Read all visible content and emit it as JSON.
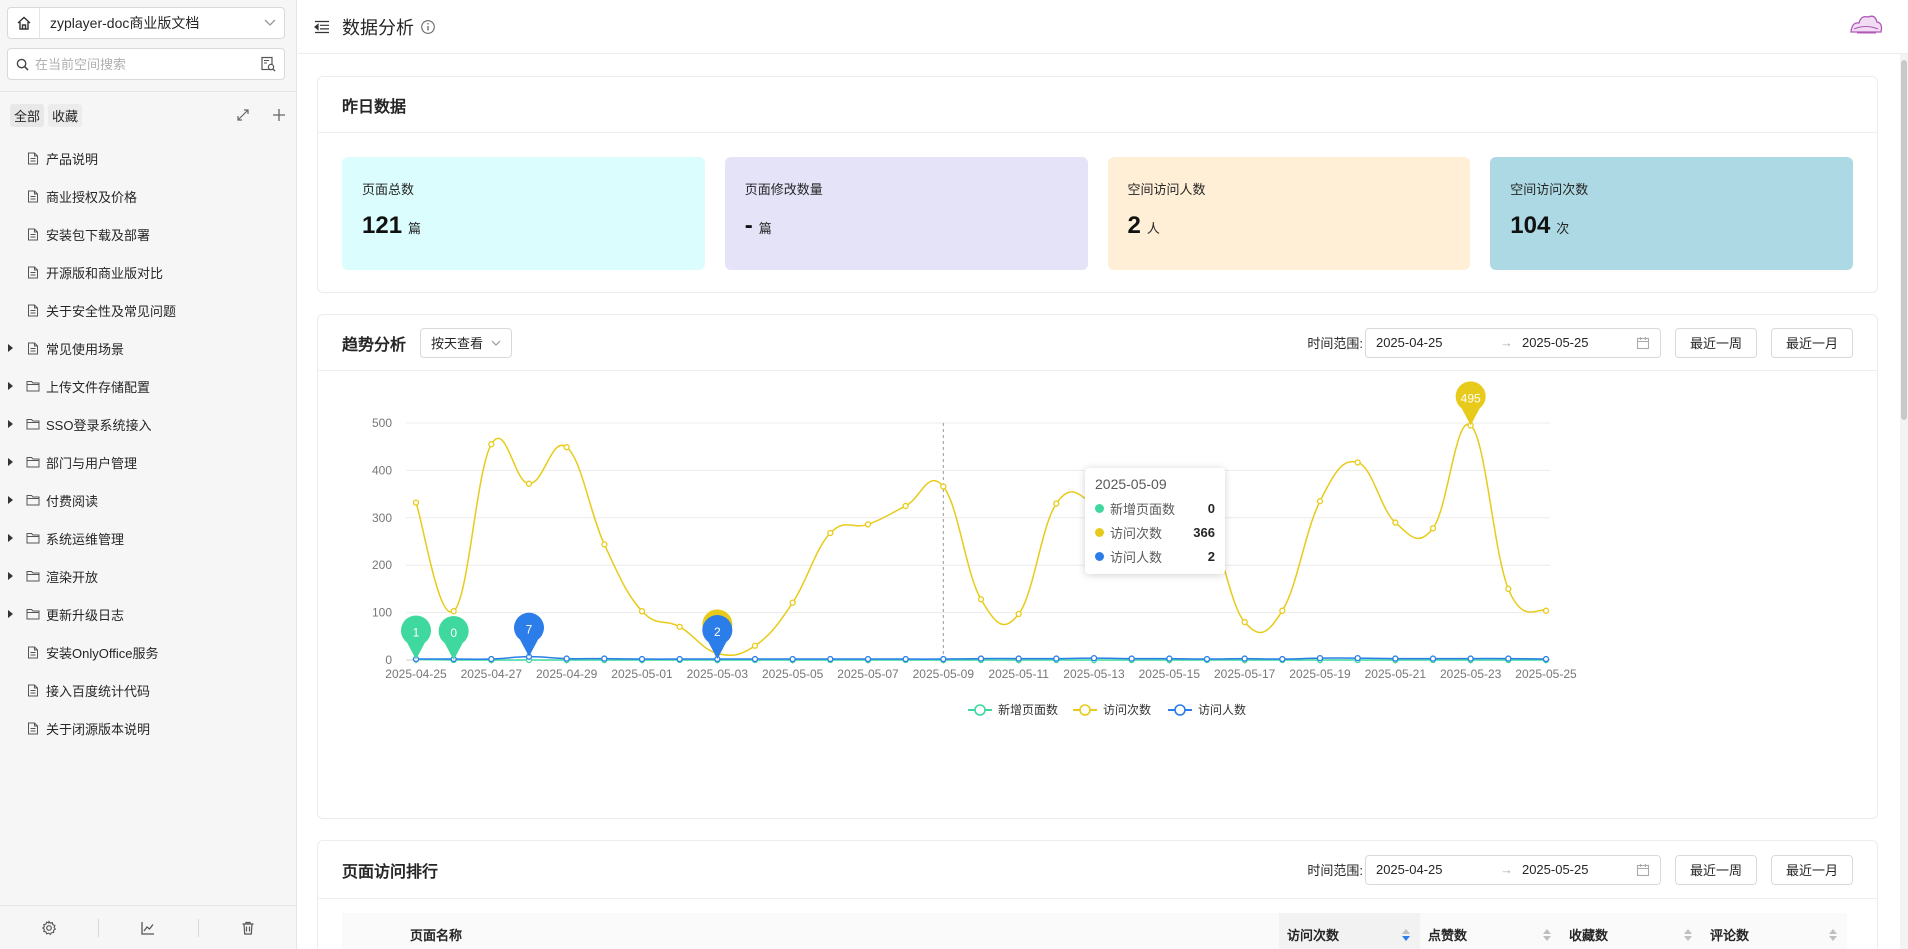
{
  "sidebar": {
    "space_name": "zyplayer-doc商业版文档",
    "search_placeholder": "在当前空间搜索",
    "filter_tabs": [
      "全部",
      "收藏"
    ],
    "tree": [
      {
        "label": "产品说明",
        "type": "doc"
      },
      {
        "label": "商业授权及价格",
        "type": "doc"
      },
      {
        "label": "安装包下载及部署",
        "type": "doc"
      },
      {
        "label": "开源版和商业版对比",
        "type": "doc"
      },
      {
        "label": "关于安全性及常见问题",
        "type": "doc"
      },
      {
        "label": "常见使用场景",
        "type": "doc-folder"
      },
      {
        "label": "上传文件存储配置",
        "type": "folder"
      },
      {
        "label": "SSO登录系统接入",
        "type": "folder"
      },
      {
        "label": "部门与用户管理",
        "type": "folder"
      },
      {
        "label": "付费阅读",
        "type": "folder"
      },
      {
        "label": "系统运维管理",
        "type": "folder"
      },
      {
        "label": "渲染开放",
        "type": "folder"
      },
      {
        "label": "更新升级日志",
        "type": "folder"
      },
      {
        "label": "安装OnlyOffice服务",
        "type": "doc"
      },
      {
        "label": "接入百度统计代码",
        "type": "doc"
      },
      {
        "label": "关于闭源版本说明",
        "type": "doc"
      }
    ]
  },
  "header": {
    "title": "数据分析"
  },
  "yesterday": {
    "title": "昨日数据",
    "cards": [
      {
        "label": "页面总数",
        "value": "121",
        "unit": "篇",
        "color": "#dcfdfd"
      },
      {
        "label": "页面修改数量",
        "value": "-",
        "unit": "篇",
        "color": "#e4e3f7"
      },
      {
        "label": "空间访问人数",
        "value": "2",
        "unit": "人",
        "color": "#feefd6"
      },
      {
        "label": "空间访问次数",
        "value": "104",
        "unit": "次",
        "color": "#acd9e3"
      }
    ]
  },
  "trend": {
    "title": "趋势分析",
    "view_mode": "按天查看",
    "range_label": "时间范围:",
    "start": "2025-04-25",
    "end": "2025-05-25",
    "btn_week": "最近一周",
    "btn_month": "最近一月"
  },
  "tooltip": {
    "date": "2025-05-09",
    "rows": [
      {
        "name": "新增页面数",
        "value": "0",
        "color": "#3fd99f"
      },
      {
        "name": "访问次数",
        "value": "366",
        "color": "#e8cb1a"
      },
      {
        "name": "访问人数",
        "value": "2",
        "color": "#2b7de9"
      }
    ]
  },
  "chart_data": {
    "type": "line",
    "title": "",
    "xlabel": "",
    "ylabel": "",
    "ylim": [
      0,
      500
    ],
    "yticks": [
      0,
      100,
      200,
      300,
      400,
      500
    ],
    "grid": true,
    "legend_position": "bottom-center",
    "x": [
      "2025-04-25",
      "2025-04-26",
      "2025-04-27",
      "2025-04-28",
      "2025-04-29",
      "2025-04-30",
      "2025-05-01",
      "2025-05-02",
      "2025-05-03",
      "2025-05-04",
      "2025-05-05",
      "2025-05-06",
      "2025-05-07",
      "2025-05-08",
      "2025-05-09",
      "2025-05-10",
      "2025-05-11",
      "2025-05-12",
      "2025-05-13",
      "2025-05-14",
      "2025-05-15",
      "2025-05-16",
      "2025-05-17",
      "2025-05-18",
      "2025-05-19",
      "2025-05-20",
      "2025-05-21",
      "2025-05-22",
      "2025-05-23",
      "2025-05-24",
      "2025-05-25"
    ],
    "xtick_labels": [
      "2025-04-25",
      "2025-04-27",
      "2025-04-29",
      "2025-05-01",
      "2025-05-03",
      "2025-05-05",
      "2025-05-07",
      "2025-05-09",
      "2025-05-11",
      "2025-05-13",
      "2025-05-15",
      "2025-05-17",
      "2025-05-19",
      "2025-05-21",
      "2025-05-23",
      "2025-05-25"
    ],
    "series": [
      {
        "name": "新增页面数",
        "color": "#3fd99f",
        "values": [
          1,
          0,
          0,
          0,
          0,
          0,
          0,
          0,
          0,
          0,
          0,
          0,
          0,
          0,
          0,
          0,
          0,
          0,
          0,
          0,
          0,
          0,
          0,
          0,
          0,
          0,
          0,
          0,
          0,
          0,
          0
        ]
      },
      {
        "name": "访问次数",
        "color": "#e8cb1a",
        "values": [
          332,
          103,
          455,
          372,
          449,
          244,
          103,
          70,
          14,
          30,
          121,
          268,
          286,
          325,
          366,
          128,
          97,
          330,
          328,
          236,
          288,
          286,
          80,
          104,
          335,
          417,
          290,
          278,
          495,
          150,
          104
        ]
      },
      {
        "name": "访问人数",
        "color": "#2b7de9",
        "values": [
          2,
          2,
          2,
          7,
          3,
          3,
          2,
          2,
          2,
          2,
          2,
          2,
          2,
          2,
          2,
          3,
          3,
          3,
          4,
          3,
          3,
          2,
          3,
          2,
          4,
          4,
          3,
          3,
          3,
          3,
          2
        ]
      }
    ],
    "markers": [
      {
        "series": 0,
        "index": 0,
        "label": "1"
      },
      {
        "series": 0,
        "index": 1,
        "label": "0"
      },
      {
        "series": 2,
        "index": 3,
        "label": "7"
      },
      {
        "series": 1,
        "index": 8,
        "label": "14"
      },
      {
        "series": 2,
        "index": 8,
        "label": "2"
      },
      {
        "series": 1,
        "index": 28,
        "label": "495"
      }
    ],
    "hover_index": 14
  },
  "ranking": {
    "title": "页面访问排行",
    "range_label": "时间范围:",
    "start": "2025-04-25",
    "end": "2025-05-25",
    "btn_week": "最近一周",
    "btn_month": "最近一月",
    "columns": [
      "页面名称",
      "访问次数",
      "点赞数",
      "收藏数",
      "评论数"
    ]
  }
}
